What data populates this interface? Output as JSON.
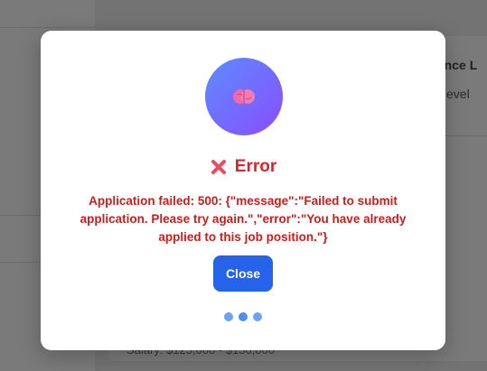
{
  "background": {
    "job_title_partial": "ience L",
    "level_partial": "evel",
    "salary_partial": "Salary: $125,000 - $150,000"
  },
  "modal": {
    "avatar_icon": "brain-icon",
    "title_icon": "cross-mark-icon",
    "title": "Error",
    "message": "Application failed: 500: {\"message\":\"Failed to submit application. Please try again.\",\"error\":\"You have already applied to this job position.\"}",
    "close_label": "Close",
    "loading_icon": "loading-dots-icon"
  },
  "colors": {
    "error_red": "#d9232d",
    "message_red": "#c81e1e",
    "button_blue": "#2563eb",
    "gradient_start": "#5b8cff",
    "gradient_end": "#8b4dff"
  }
}
